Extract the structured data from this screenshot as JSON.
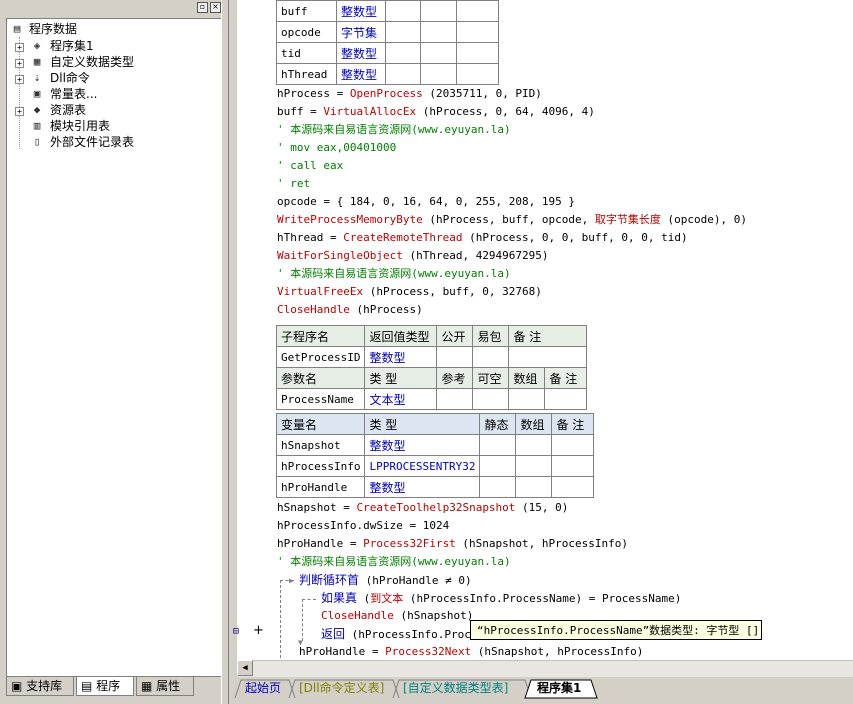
{
  "left_panel": {
    "toolbar": {
      "pin": "▫",
      "close": "×"
    },
    "tree": [
      {
        "label": "程序数据",
        "icon": "program-data-icon",
        "glyph": "▤"
      },
      {
        "label": "程序集1",
        "icon": "assembly-icon",
        "glyph": "◈"
      },
      {
        "label": "自定义数据类型",
        "icon": "data-type-icon",
        "glyph": "▦"
      },
      {
        "label": "Dll命令",
        "icon": "dll-command-icon",
        "glyph": "⇣"
      },
      {
        "label": "常量表...",
        "icon": "constant-table-icon",
        "glyph": "▣"
      },
      {
        "label": "资源表",
        "icon": "resource-table-icon",
        "glyph": "◆"
      },
      {
        "label": "模块引用表",
        "icon": "module-reference-icon",
        "glyph": "▥"
      },
      {
        "label": "外部文件记录表",
        "icon": "external-file-icon",
        "glyph": "▯"
      }
    ],
    "tabs": [
      {
        "label": "支持库",
        "icon": "support-library-icon"
      },
      {
        "label": "程序",
        "icon": "program-icon"
      },
      {
        "label": "属性",
        "icon": "properties-icon"
      }
    ]
  },
  "editor": {
    "top_table": [
      {
        "name": "buff",
        "type": "整数型"
      },
      {
        "name": "opcode",
        "type": "字节集"
      },
      {
        "name": "tid",
        "type": "整数型"
      },
      {
        "name": "hThread",
        "type": "整数型"
      }
    ],
    "code_block_1": [
      [
        {
          "t": "hProcess = "
        },
        {
          "t": "OpenProcess",
          "c": "fn"
        },
        {
          "t": " (2035711, 0, PID)"
        }
      ],
      [
        {
          "t": "buff = "
        },
        {
          "t": "VirtualAllocEx",
          "c": "fn"
        },
        {
          "t": " (hProcess, 0, 64, 4096, 4)"
        }
      ],
      [
        {
          "t": "' 本源码来自易语言资源网(www.eyuyan.la)",
          "c": "cm"
        }
      ],
      [
        {
          "t": "' mov eax,00401000",
          "c": "cm"
        }
      ],
      [
        {
          "t": "' call eax",
          "c": "cm"
        }
      ],
      [
        {
          "t": "' ret",
          "c": "cm"
        }
      ],
      [
        {
          "t": "opcode = { 184, 0, 16, 64, 0, 255, 208, 195 }"
        }
      ],
      [
        {
          "t": "WriteProcessMemoryByte",
          "c": "fn"
        },
        {
          "t": " (hProcess, buff, opcode, "
        },
        {
          "t": "取字节集长度",
          "c": "fn"
        },
        {
          "t": " (opcode), 0)"
        }
      ],
      [
        {
          "t": "hThread = "
        },
        {
          "t": "CreateRemoteThread",
          "c": "fn"
        },
        {
          "t": " (hProcess, 0, 0, buff, 0, 0, tid)"
        }
      ],
      [
        {
          "t": "WaitForSingleObject",
          "c": "fn"
        },
        {
          "t": " (hThread, 4294967295)"
        }
      ],
      [
        {
          "t": "' 本源码来自易语言资源网(www.eyuyan.la)",
          "c": "cm"
        }
      ],
      [
        {
          "t": "VirtualFreeEx",
          "c": "fn"
        },
        {
          "t": " (hProcess, buff, 0, 32768)"
        }
      ],
      [
        {
          "t": "CloseHandle",
          "c": "fn"
        },
        {
          "t": " (hProcess)"
        }
      ]
    ],
    "sub_table": {
      "headers": [
        "子程序名",
        "返回值类型",
        "公开",
        "易包",
        "备 注"
      ],
      "row": [
        "GetProcessID",
        "整数型",
        "",
        "",
        ""
      ],
      "param_headers": [
        "参数名",
        "类 型",
        "参考",
        "可空",
        "数组",
        "备 注"
      ],
      "param_row": [
        "ProcessName",
        "文本型",
        "",
        "",
        "",
        ""
      ]
    },
    "var_table": {
      "headers": [
        "变量名",
        "类 型",
        "静态",
        "数组",
        "备 注"
      ],
      "rows": [
        [
          "hSnapshot",
          "整数型"
        ],
        [
          "hProcessInfo",
          "LPPROCESSENTRY32"
        ],
        [
          "hProHandle",
          "整数型"
        ]
      ]
    },
    "code_block_2": [
      [
        {
          "t": "hSnapshot = "
        },
        {
          "t": "CreateToolhelp32Snapshot",
          "c": "fn"
        },
        {
          "t": " (15, 0)"
        }
      ],
      [
        {
          "t": "hProcessInfo.dwSize = 1024"
        }
      ],
      [
        {
          "t": "hProHandle = "
        },
        {
          "t": "Process32First",
          "c": "fn"
        },
        {
          "t": " (hSnapshot, hProcessInfo)"
        }
      ],
      [
        {
          "t": "' 本源码来自易语言资源网(www.eyuyan.la)",
          "c": "cm"
        }
      ]
    ],
    "loop_line": [
      {
        "t": "判断循环首",
        "c": "kw"
      },
      {
        "t": " (hProHandle ≠ 0)"
      }
    ],
    "if_line": [
      {
        "t": "如果真",
        "c": "kw"
      },
      {
        "t": " ("
      },
      {
        "t": "到文本",
        "c": "fn"
      },
      {
        "t": " (hProcessInfo.ProcessName) = ProcessName)"
      }
    ],
    "close_line": [
      {
        "t": "CloseHandle",
        "c": "fn"
      },
      {
        "t": " (hSnapshot)"
      }
    ],
    "return_line": [
      {
        "t": "返回",
        "c": "kw"
      },
      {
        "t": " (hProcessInfo.Proces"
      }
    ],
    "next_line": [
      {
        "t": "hProHandle = "
      },
      {
        "t": "Process32Next",
        "c": "fn"
      },
      {
        "t": " (hSnapshot, hProcessInfo)"
      }
    ],
    "tooltip": "“hProcessInfo.ProcessName”数据类型: 字节型 []",
    "gutter_plus": "+"
  },
  "bottom_tabs": [
    {
      "label": "起始页",
      "color": "#0000c0"
    },
    {
      "label": "[Dll命令定义表]",
      "color": "#808000"
    },
    {
      "label": "[自定义数据类型表]",
      "color": "#008080"
    },
    {
      "label": "程序集1",
      "color": "#000000"
    }
  ]
}
